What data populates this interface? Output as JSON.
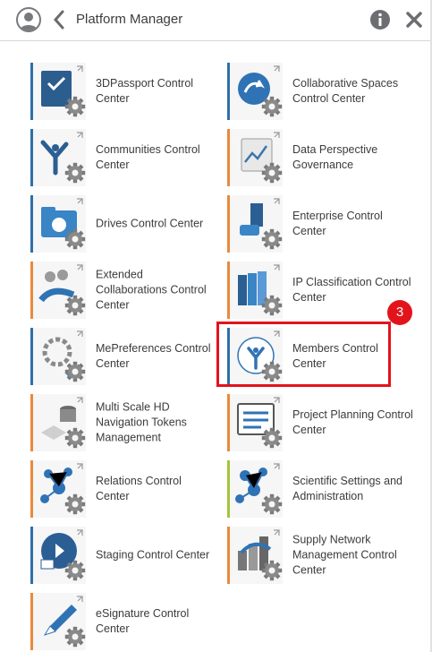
{
  "header": {
    "title": "Platform Manager",
    "back_icon": "chevron-left-icon",
    "info_icon": "info-icon",
    "close_icon": "close-icon",
    "avatar_icon": "user-avatar-icon"
  },
  "colors": {
    "accent_blue": "#2f6fa8",
    "accent_orange": "#e98a3c",
    "highlight_red": "#e3131b"
  },
  "tiles": [
    {
      "label": "3DPassport Control Center",
      "icon": "passport-gear-icon",
      "accent": "#2f6fa8"
    },
    {
      "label": "Collaborative Spaces Control Center",
      "icon": "collab-spaces-gear-icon",
      "accent": "#2f6fa8"
    },
    {
      "label": "Communities Control Center",
      "icon": "communities-gear-icon",
      "accent": "#2f6fa8"
    },
    {
      "label": "Data Perspective Governance",
      "icon": "data-perspective-icon",
      "accent": "#e98a3c"
    },
    {
      "label": "Drives Control Center",
      "icon": "drives-gear-icon",
      "accent": "#2f6fa8"
    },
    {
      "label": "Enterprise Control Center",
      "icon": "enterprise-gear-icon",
      "accent": "#e98a3c"
    },
    {
      "label": "Extended Collaborations Control Center",
      "icon": "extended-collab-icon",
      "accent": "#e98a3c"
    },
    {
      "label": "IP Classification Control Center",
      "icon": "ip-classification-icon",
      "accent": "#e98a3c"
    },
    {
      "label": "MePreferences Control Center",
      "icon": "mepreferences-icon",
      "accent": "#2f6fa8"
    },
    {
      "label": "Members Control Center",
      "icon": "members-gear-icon",
      "accent": "#2f6fa8"
    },
    {
      "label": "Multi Scale HD Navigation Tokens Management",
      "icon": "multiscale-tokens-icon",
      "accent": "#e98a3c"
    },
    {
      "label": "Project Planning Control Center",
      "icon": "project-planning-icon",
      "accent": "#e98a3c"
    },
    {
      "label": "Relations Control Center",
      "icon": "relations-gear-icon",
      "accent": "#e98a3c"
    },
    {
      "label": "Scientific Settings and Administration",
      "icon": "scientific-settings-icon",
      "accent": "#a3c43a"
    },
    {
      "label": "Staging Control Center",
      "icon": "staging-gear-icon",
      "accent": "#2f6fa8"
    },
    {
      "label": "Supply Network Management Control Center",
      "icon": "supply-network-icon",
      "accent": "#e98a3c"
    },
    {
      "label": "eSignature Control Center",
      "icon": "esignature-icon",
      "accent": "#e98a3c"
    }
  ],
  "annotation": {
    "step_number": "3"
  }
}
